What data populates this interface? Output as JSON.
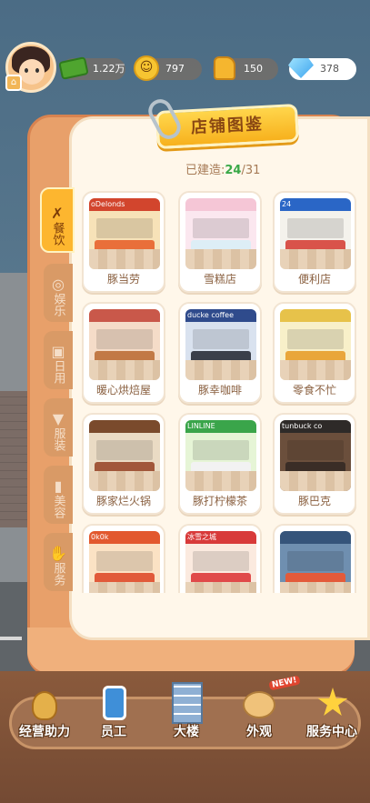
{
  "resources": {
    "cash": "1.22万",
    "happiness": "797",
    "likes": "150",
    "gems": "378"
  },
  "panel": {
    "title": "店铺图鉴",
    "built_label": "已建造:",
    "built_count": "24",
    "built_total": "/31"
  },
  "tabs": [
    {
      "label": "餐饮",
      "icon": "fork-spoon-icon",
      "active": true
    },
    {
      "label": "娱乐",
      "icon": "gamepad-icon",
      "active": false
    },
    {
      "label": "日用",
      "icon": "bag-icon",
      "active": false
    },
    {
      "label": "服装",
      "icon": "shirt-icon",
      "active": false
    },
    {
      "label": "美容",
      "icon": "lipstick-icon",
      "active": false
    },
    {
      "label": "服务",
      "icon": "handshake-icon",
      "active": false
    }
  ],
  "shops": [
    {
      "name": "豚当劳",
      "sign": "oDelonds",
      "sign_color": "#d2452d",
      "wall": "#f7e2b8",
      "counter": "#e96f3a"
    },
    {
      "name": "雪糕店",
      "sign": "",
      "sign_color": "#f5c6d6",
      "wall": "#fbe7ef",
      "counter": "#ddeef6"
    },
    {
      "name": "便利店",
      "sign": "24",
      "sign_color": "#2a66c6",
      "wall": "#f4f2ec",
      "counter": "#d9534a"
    },
    {
      "name": "暖心烘焙屋",
      "sign": "",
      "sign_color": "#c9584a",
      "wall": "#f5dcc8",
      "counter": "#c27946"
    },
    {
      "name": "豚幸咖啡",
      "sign": "ducke coffee",
      "sign_color": "#2f4b8c",
      "wall": "#d9e2ef",
      "counter": "#3a3f4a"
    },
    {
      "name": "零食不忙",
      "sign": "",
      "sign_color": "#e7c24a",
      "wall": "#f8f0c9",
      "counter": "#e9a63a"
    },
    {
      "name": "豚家烂火锅",
      "sign": "",
      "sign_color": "#7a4a2c",
      "wall": "#eadbc4",
      "counter": "#a1573a"
    },
    {
      "name": "豚打柠檬茶",
      "sign": "LINLINE",
      "sign_color": "#3aa54a",
      "wall": "#e6f5d6",
      "counter": "#f2f2f2"
    },
    {
      "name": "豚巴克",
      "sign": "tunbuck co",
      "sign_color": "#2e2a28",
      "wall": "#6b4f3c",
      "counter": "#3a2d26"
    },
    {
      "name": "",
      "sign": "0k0k",
      "sign_color": "#e2582e",
      "wall": "#fbe2c4",
      "counter": "#e15a3a"
    },
    {
      "name": "",
      "sign": "冰雪之城",
      "sign_color": "#d83a3a",
      "wall": "#fbeadf",
      "counter": "#e04a4a"
    },
    {
      "name": "",
      "sign": "",
      "sign_color": "#35547a",
      "wall": "#6f8fb0",
      "counter": "#e35a3a"
    }
  ],
  "bottom_nav": [
    {
      "label": "经营助力",
      "icon": "bag-coins-icon"
    },
    {
      "label": "员工",
      "icon": "badge-icon"
    },
    {
      "label": "大楼",
      "icon": "building-icon"
    },
    {
      "label": "外观",
      "icon": "palette-icon",
      "badge": "NEW!"
    },
    {
      "label": "服务中心",
      "icon": "star-icon"
    }
  ]
}
